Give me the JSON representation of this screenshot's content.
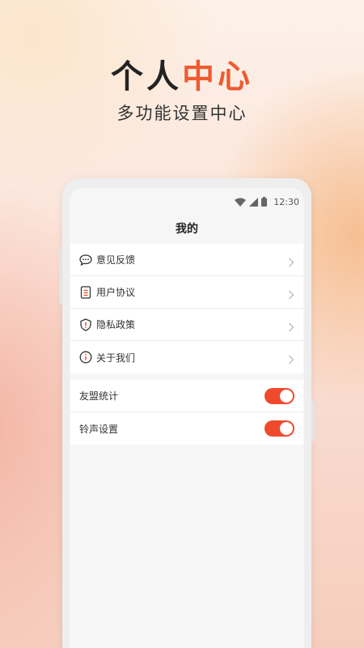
{
  "hero": {
    "title_main": "个人",
    "title_accent": "中心",
    "subtitle": "多功能设置中心"
  },
  "status_bar": {
    "time": "12:30",
    "icons": [
      "wifi-icon",
      "signal-icon",
      "battery-icon"
    ]
  },
  "page": {
    "title": "我的"
  },
  "menu": {
    "items": [
      {
        "label": "意见反馈",
        "icon": "chat-bubble-icon"
      },
      {
        "label": "用户协议",
        "icon": "document-icon"
      },
      {
        "label": "隐私政策",
        "icon": "shield-icon"
      },
      {
        "label": "关于我们",
        "icon": "info-icon"
      }
    ]
  },
  "toggles": {
    "items": [
      {
        "label": "友盟统计",
        "on": true
      },
      {
        "label": "铃声设置",
        "on": true
      }
    ]
  },
  "colors": {
    "accent": "#ef5a2f",
    "switch_on": "#ef4a2c"
  }
}
